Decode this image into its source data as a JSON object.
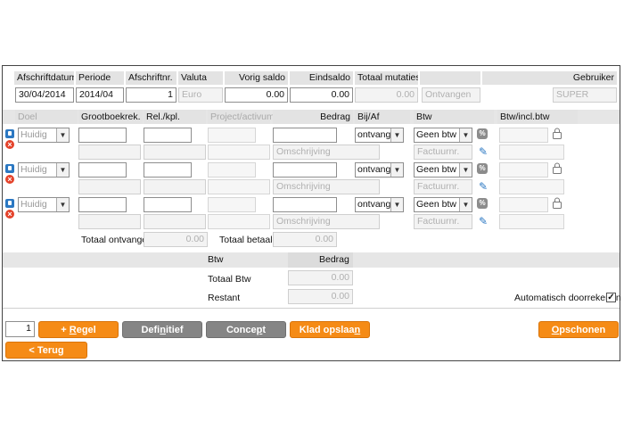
{
  "header": {
    "labels": {
      "afschriftdatum": "Afschriftdatum",
      "periode": "Periode",
      "afschriftnr": "Afschriftnr.",
      "valuta": "Valuta",
      "vorig_saldo": "Vorig saldo",
      "eindsaldo": "Eindsaldo",
      "totaal_mutaties": "Totaal mutaties",
      "gebruiker": "Gebruiker"
    },
    "values": {
      "afschriftdatum": "30/04/2014",
      "periode": "2014/04",
      "afschriftnr": "1",
      "valuta": "Euro",
      "vorig_saldo": "0.00",
      "eindsaldo": "0.00",
      "totaal_mutaties": "0.00",
      "mutatie_type": "Ontvangen",
      "gebruiker": "SUPER"
    }
  },
  "columns": {
    "doel": "Doel",
    "grootboek": "Grootboekrek.",
    "relkpl": "Rel./kpl.",
    "project": "Project/activum",
    "bedrag": "Bedrag",
    "bijaf": "Bij/Af",
    "btw": "Btw",
    "btwincl": "Btw/incl.btw"
  },
  "rows": [
    {
      "doel": "Huidig",
      "omschrijving": "Omschrijving",
      "bijaf": "ontvangen",
      "btw": "Geen btw",
      "factuur": "Factuurnr."
    },
    {
      "doel": "Huidig",
      "omschrijving": "Omschrijving",
      "bijaf": "ontvangen",
      "btw": "Geen btw",
      "factuur": "Factuurnr."
    },
    {
      "doel": "Huidig",
      "omschrijving": "Omschrijving",
      "bijaf": "ontvangen",
      "btw": "Geen btw",
      "factuur": "Factuurnr."
    }
  ],
  "totals": {
    "ontvangen_label": "Totaal ontvangen",
    "ontvangen_value": "0.00",
    "betaald_label": "Totaal betaald",
    "betaald_value": "0.00"
  },
  "btw_summary": {
    "col_btw": "Btw",
    "col_bedrag": "Bedrag",
    "totaal_btw_label": "Totaal Btw",
    "totaal_btw_value": "0.00",
    "restant_label": "Restant",
    "restant_value": "0.00",
    "auto_label": "Automatisch doorrekenen",
    "auto_checked": "✓"
  },
  "footer": {
    "regel_count": "1",
    "btn_regel_prefix": "+ ",
    "btn_regel_accel": "R",
    "btn_regel_rest": "egel",
    "btn_definitief_pre": "Defi",
    "btn_definitief_accel": "n",
    "btn_definitief_post": "itief",
    "btn_concept_pre": "Conce",
    "btn_concept_accel": "p",
    "btn_concept_post": "t",
    "btn_klad_pre": "Klad opslaa",
    "btn_klad_accel": "n",
    "btn_opschonen_accel": "O",
    "btn_opschonen_rest": "pschonen",
    "btn_terug": "< Terug"
  },
  "colors": {
    "accent_orange": "#f58b16",
    "grey_button": "#858585",
    "header_bg": "#e3e3e3",
    "icon_blue": "#2b78c2",
    "icon_red": "#e4422a"
  }
}
